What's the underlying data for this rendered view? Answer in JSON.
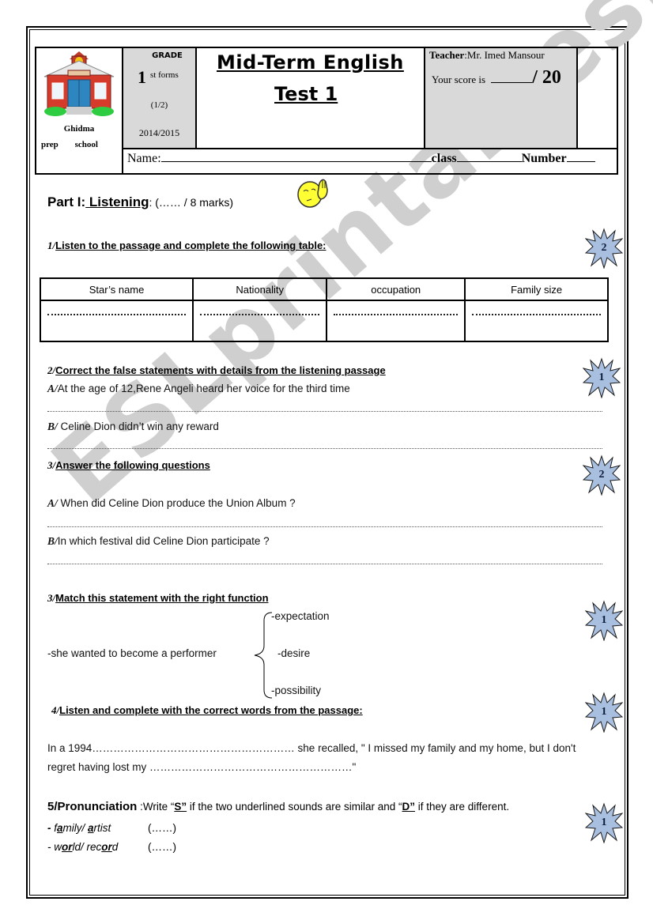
{
  "watermark": "ESLprintables.com",
  "header": {
    "school": {
      "line1": "Ghidma",
      "line2a": "prep",
      "line2b": "school",
      "logo_icon": "school-house-icon"
    },
    "grade": {
      "label": "GRADE",
      "number": "1",
      "suffix": "st forms",
      "part": "(1/2)",
      "year": "2014/2015"
    },
    "title": {
      "line1": "Mid-Term English",
      "line2": "Test 1"
    },
    "teacher": {
      "label": "Teacher",
      "name": ":Mr.  Imed Mansour"
    },
    "score": {
      "label": "Your score is",
      "max": "/ 20"
    },
    "name_row": {
      "name_label": "Name:",
      "class_label": "class",
      "number_label": "Number"
    }
  },
  "part1": {
    "label": "Part I:",
    "title": " Listening",
    "marks": ": (…… / 8 marks)",
    "icon": "thinking-face-icon"
  },
  "questions": {
    "q1": {
      "num": "1/",
      "heading": "Listen  to the passage and complete the following table:",
      "badge": "2",
      "table": {
        "headers": [
          "Star’s name",
          "Nationality",
          "occupation",
          "Family size"
        ]
      }
    },
    "q2": {
      "num": "2/",
      "heading": "Correct the false statements  with details from the listening passage",
      "badge": "1",
      "items": [
        {
          "letter": "A/",
          "text": "At the age of 12,Rene Angeli heard her voice for the third time"
        },
        {
          "letter": "B/",
          "text": " Celine Dion didn’t win any reward"
        }
      ]
    },
    "q3": {
      "num": "3/",
      "heading": "Answer the following questions",
      "badge": "2",
      "items": [
        {
          "letter": "A/",
          "text": " When did Celine Dion produce the Union Album ?"
        },
        {
          "letter": "B/",
          "text": "In which festival did Celine Dion participate ?"
        }
      ]
    },
    "q3b": {
      "num": "3/",
      "heading": "Match this statement with the right function",
      "badge": "1",
      "statement": "-she wanted to become a performer",
      "options": [
        "-expectation",
        "-desire",
        "-possibility"
      ]
    },
    "q4": {
      "num": "4/",
      "heading": "Listen and complete with the correct words from the passage:",
      "badge": "1",
      "line1": "In a 1994………………………………………………… she recalled, \" I missed my family and my home, but I don't",
      "line2": "regret having  lost my  …………………………………………………\""
    },
    "q5": {
      "label": "5/Pronunciation",
      "instruction_a": " :Write “",
      "s_letter": "S”",
      "instruction_b": " if the two  underlined sounds are similar and “",
      "d_letter": "D”",
      "instruction_c": " if they are different.",
      "badge": "1",
      "items": [
        {
          "prefix": "- ",
          "w1a": "f",
          "w1u": "a",
          "w1b": "mily/ ",
          "w2a": "",
          "w2u": "a",
          "w2b": "rtist",
          "answer": "(……)"
        },
        {
          "prefix": "- ",
          "w1a": "w",
          "w1u": "or",
          "w1b": "ld/ ",
          "w2a": "rec",
          "w2u": "or",
          "w2b": "d",
          "answer": "(……)"
        }
      ]
    }
  },
  "colors": {
    "badge_fill": "#a9bfdf",
    "badge_stroke": "#1a1a1a",
    "header_gray": "#d9d9d9",
    "watermark": "#cfcfcf"
  }
}
